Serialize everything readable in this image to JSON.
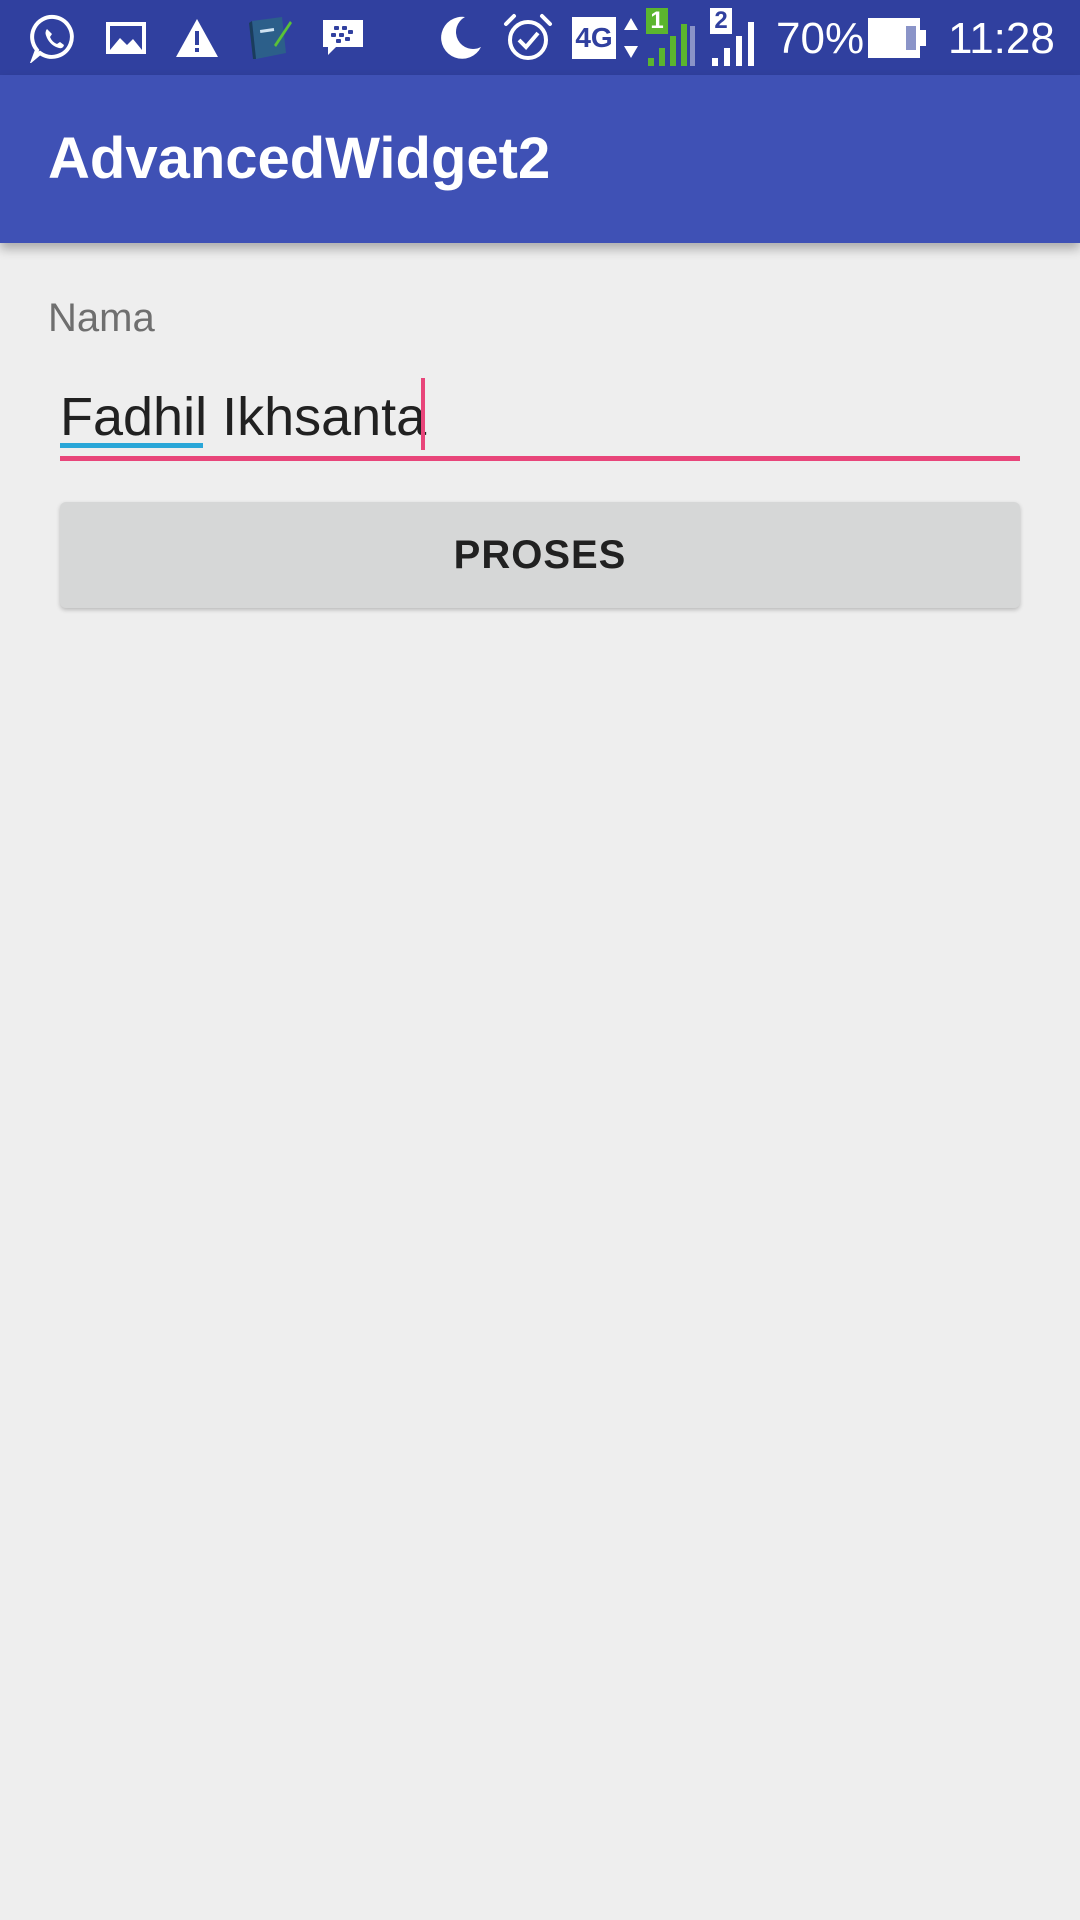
{
  "status_bar": {
    "left_icons": [
      "whatsapp-icon",
      "gallery-icon",
      "warning-icon",
      "notebook-app-icon",
      "bbm-icon"
    ],
    "right_icons": [
      "do-not-disturb-moon-icon",
      "alarm-clock-icon",
      "network-4g-icon",
      "data-arrows-icon",
      "signal-sim1-icon",
      "signal-sim2-icon",
      "battery-icon"
    ],
    "network_type": "4G",
    "sim1_label": "1",
    "sim2_label": "2",
    "battery_percent": "70%",
    "battery_level": 0.7,
    "time": "11:28"
  },
  "app_bar": {
    "title": "AdvancedWidget2",
    "color": "#3f51b5"
  },
  "form": {
    "name_label": "Nama",
    "name_value": "Fadhil Ikhsanta",
    "accent_color": "#e8457a",
    "submit_label": "PROSES"
  }
}
